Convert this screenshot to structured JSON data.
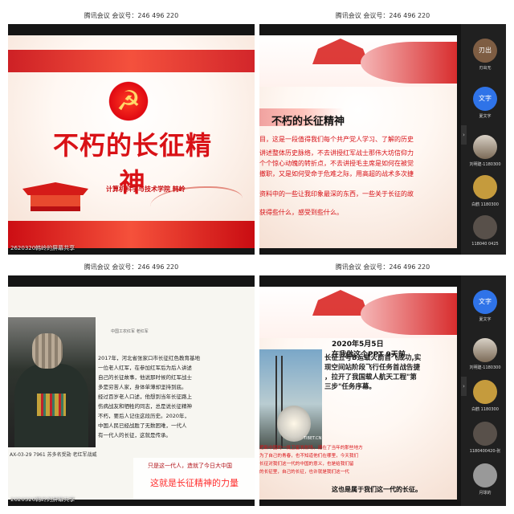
{
  "meeting": {
    "title": "腾讯会议 会议号：246 496 220"
  },
  "screens": [
    {
      "caption": "2620320韩岭的屏幕共享",
      "slide": {
        "title": "不朽的长征精神",
        "subtitle": "计算机科学与技术学院",
        "presenter": "韩岭"
      }
    },
    {
      "slide": {
        "title": "不朽的长征精神",
        "body": [
          "目，这是一段值得我们每个共产党人学习、了解的历史",
          "讲述整体历史脉络，不去讲授红军战士那伟大坊信仰力",
          "个个惊心动魄的转折点，不去讲授毛主席是如何在被觉",
          "撤职，又是如何受命于危难之际，用高超的战术多次捷",
          "资料中的一些让我印象最深的东西，一些关于长征的故",
          "获得些什么，感受到些什么。"
        ]
      },
      "participants": [
        {
          "label": "刃出",
          "name": "刃出无"
        },
        {
          "label": "文字",
          "name": "夏文字"
        },
        {
          "label": "",
          "name": "刘明建-1180300"
        },
        {
          "label": "",
          "name": "白鹤 1180300"
        },
        {
          "label": "",
          "name": "118040 0425"
        }
      ]
    },
    {
      "caption": "2620320韩岭的屏幕共享",
      "portrait_caption": "AX-03-29 7961 苏多名受勋\n老红军战威",
      "doc_header": "中国工农红军 老红军",
      "paragraphs": [
        "2017年，河北省张家口市长征红色教育基地",
        "一位老人红军，在参加红军后为后人讲述",
        "自己的长征故事，他说那时候的红军战士",
        "多是穷苦人家，身体单薄却坚持到底。",
        "经过百岁老人口述，他想到当年长征路上",
        "伤病战友和牺牲的同志，总是说长征精神",
        "不朽，要后人记住这段历史。2020年，",
        "中国人民已经战胜了无数困难，一代人",
        "有一代人的长征，这就是传承。"
      ],
      "quote": "只是这一代人，造就了今日大中国",
      "slogan": "这就是长征精神的力量"
    },
    {
      "date": "2020年5月5日",
      "lead": "在我做这个PPT 9天前",
      "headline": [
        "长征五号B运载火箭首飞成功,实",
        "现空间站阶段飞行任务首战告捷",
        "，拉开了我国载人航天工程\"第",
        "三步\"任务序幕。"
      ],
      "watermark": "TIBET.CN",
      "lower_text": [
        "把新中国的一批卫星发射场，建在了当年的那些地方",
        "为了自己的青春，也不知道他们在哪里，今天我们",
        "长征对我们这一代的中国的意义，也是给我们留",
        "的长征里，自己的长征，也许就是我们这一代"
      ],
      "final": "这也是属于我们这一代的长征。",
      "participants": [
        {
          "label": "文字",
          "name": "夏文字"
        },
        {
          "label": "",
          "name": "刘明建-1180300"
        },
        {
          "label": "",
          "name": "白鹤 1180300"
        },
        {
          "label": "",
          "name": "1180400420-张"
        },
        {
          "label": "",
          "name": "月球的"
        }
      ]
    }
  ]
}
